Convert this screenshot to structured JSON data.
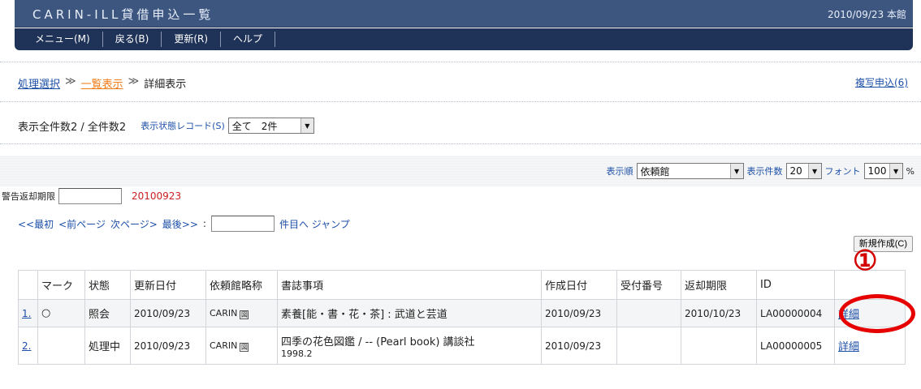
{
  "header": {
    "title": "CARIN-ILL貸借申込一覧",
    "date_library": "2010/09/23 本館"
  },
  "menu": [
    {
      "label": "メニュー(M)"
    },
    {
      "label": "戻る(B)"
    },
    {
      "label": "更新(R)"
    },
    {
      "label": "ヘルプ"
    }
  ],
  "breadcrumb": {
    "step1": "処理選択",
    "sep": "≫",
    "step2": "一覧表示",
    "step3": "詳細表示"
  },
  "copy_request_link": "複写申込(6)",
  "counts": {
    "text": "表示全件数2 / 全件数2",
    "status_label": "表示状態レコード(S)",
    "status_select": "全て　2件"
  },
  "display_options": {
    "order_label": "表示順",
    "order_value": "依頼館",
    "count_label": "表示件数",
    "count_value": "20",
    "font_label": "フォント",
    "font_value": "100",
    "font_unit": "%"
  },
  "warning": {
    "label": "警告返却期限",
    "input_value": "",
    "date": "20100923"
  },
  "pager": {
    "first": "<<最初",
    "prev": "<前ページ",
    "next": "次ページ>",
    "last": "最後>>",
    "colon": ":",
    "jump_input": "",
    "jump_label": "件目へ ジャンプ"
  },
  "new_button": "新規作成(C)",
  "annotation": {
    "number": "①"
  },
  "table": {
    "headers": [
      "",
      "マーク",
      "状態",
      "更新日付",
      "依頼館略称",
      "書誌事項",
      "作成日付",
      "受付番号",
      "返却期限",
      "ID",
      ""
    ],
    "rows": [
      {
        "num": "1.",
        "mark": "○",
        "status": "照会",
        "updated": "2010/09/23",
        "library": "CARIN",
        "library_icon": "図",
        "bib": "素養[能・書・花・茶] : 武道と芸道",
        "bib2": "",
        "created": "2010/09/23",
        "receipt": "",
        "due": "2010/10/23",
        "id": "LA00000004",
        "detail": "詳細"
      },
      {
        "num": "2.",
        "mark": "",
        "status": "処理中",
        "updated": "2010/09/23",
        "library": "CARIN",
        "library_icon": "図",
        "bib": "四季の花色図鑑 / -- (Pearl book) 講談社",
        "bib2": "1998.2",
        "created": "2010/09/23",
        "receipt": "",
        "due": "",
        "id": "LA00000005",
        "detail": "詳細"
      }
    ]
  }
}
